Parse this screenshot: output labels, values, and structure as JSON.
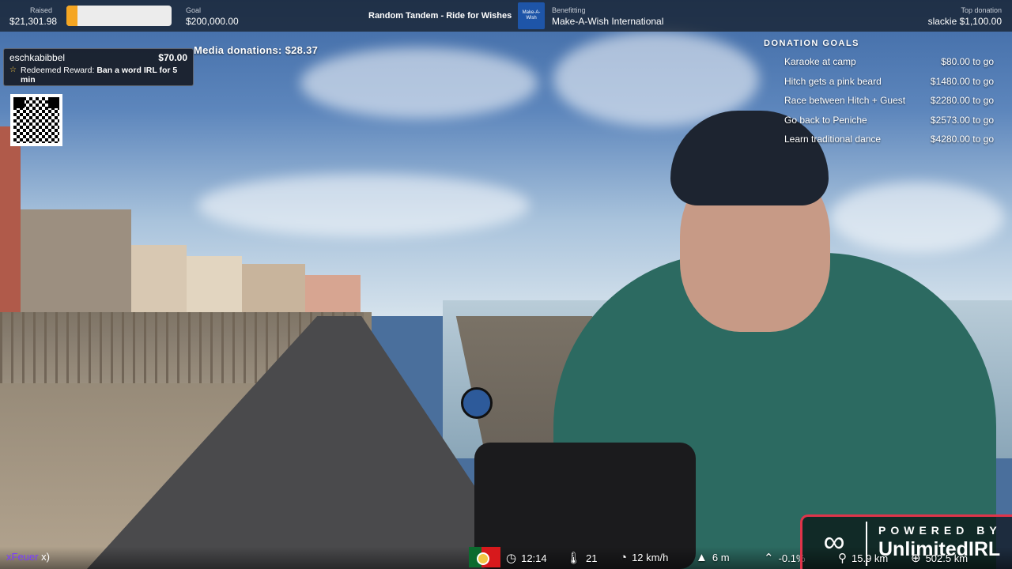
{
  "topbar": {
    "raised_label": "Raised",
    "raised_value": "$21,301.98",
    "progress_fraction": 0.106,
    "goal_label": "Goal",
    "goal_value": "$200,000.00",
    "stream_title": "Random Tandem - Ride for Wishes",
    "logo_text": "Make-A-Wish",
    "benefitting_label": "Benefitting",
    "benefitting_value": "Make-A-Wish International",
    "top_donation_label": "Top donation",
    "top_donation_value": "slackie $1,100.00",
    "accent_color": "#f5a623"
  },
  "redemption": {
    "user": "eschkabibbel",
    "amount": "$70.00",
    "reward_prefix": "Redeemed Reward: ",
    "reward_name": "Ban a word IRL for 5 min",
    "icon": "star-icon"
  },
  "media_donations": "Media donations: $28.37",
  "donation_goals": {
    "heading": "DONATION GOALS",
    "items": [
      {
        "name": "Karaoke at camp",
        "amount": "$80.00 to go"
      },
      {
        "name": "Hitch gets a pink beard",
        "amount": "$1480.00 to go"
      },
      {
        "name": "Race between Hitch + Guest",
        "amount": "$2280.00 to go"
      },
      {
        "name": "Go back to Peniche",
        "amount": "$2573.00 to go"
      },
      {
        "name": "Learn traditional dance",
        "amount": "$4280.00 to go"
      }
    ]
  },
  "chat": {
    "user": "xFeuer",
    "suffix": " x)"
  },
  "stats": {
    "time": "12:14",
    "temperature": "21",
    "speed": "12 km/h",
    "elevation": "6 m",
    "incline": "-0.1%",
    "distance": "15.9 km",
    "total_distance": "502.5 km"
  },
  "powered": {
    "line1": "POWERED BY",
    "line2": "UnlimitedIRL"
  }
}
